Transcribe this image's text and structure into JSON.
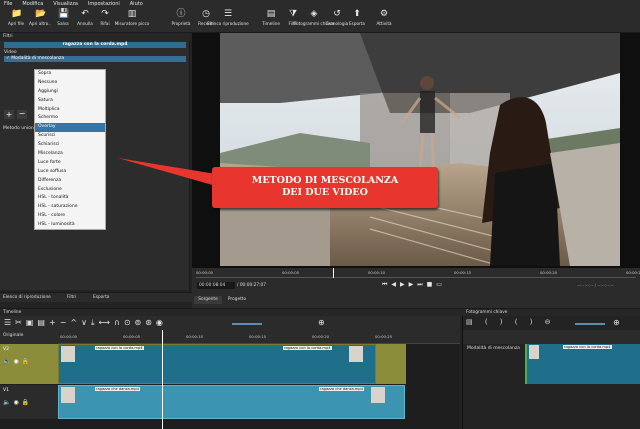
{
  "menu": [
    "File",
    "Modifica",
    "Visualizza",
    "Impostazioni",
    "Aiuto"
  ],
  "toolbar": [
    {
      "label": "Apri file",
      "icon": "folder-icon"
    },
    {
      "label": "Apri altro..",
      "icon": "folder-open-icon"
    },
    {
      "label": "Salva",
      "icon": "save-icon"
    },
    {
      "label": "Annulla",
      "icon": "undo-icon"
    },
    {
      "label": "Rifai",
      "icon": "redo-icon"
    },
    {
      "label": "Misuratore picco",
      "icon": "meter-icon"
    },
    {
      "label": "Proprietà",
      "icon": "info-icon"
    },
    {
      "label": "Recenti",
      "icon": "clock-icon"
    },
    {
      "label": "Elenco riproduzione",
      "icon": "list-icon"
    },
    {
      "label": "Timeline",
      "icon": "timeline-icon"
    },
    {
      "label": "Filtri",
      "icon": "filter-icon"
    },
    {
      "label": "Fotogrammi chiave",
      "icon": "keyframe-icon"
    },
    {
      "label": "Cronologia",
      "icon": "history-icon"
    },
    {
      "label": "Esporta",
      "icon": "export-icon"
    },
    {
      "label": "Attività",
      "icon": "jobs-icon"
    }
  ],
  "filters": {
    "panel_title": "Filtri",
    "clip_name": "ragazza con la corda.mp4",
    "section": "Video",
    "item": "✓ Modalità di mescolanza",
    "mode_label": "Metodo unione",
    "modes": [
      "Sopra",
      "Nessuno",
      "Aggiungi",
      "Satura",
      "Moltiplica",
      "Schermo",
      "Overlay",
      "Scurisci",
      "Schiarisci",
      "Miscelanza",
      "Luce forte",
      "Luce soffusa",
      "Differenza",
      "Esclusione",
      "HSL - tonalità",
      "HSL - saturazione",
      "HSL - colore",
      "HSL - luminosità"
    ],
    "selected": "Overlay"
  },
  "callout": [
    "METODO DI MESCOLANZA",
    "DEI DUE VIDEO"
  ],
  "player": {
    "ticks": [
      "00:00:00",
      "00:00:05",
      "00:00:10",
      "00:00:15",
      "00:00:20",
      "00:00:25"
    ],
    "position": "00:00:08:04",
    "duration": "/ 00:00:27:07",
    "tab_source": "Sorgente",
    "tab_project": "Progetto",
    "timecode_right": "--:--:--:-- / --:--:--:--"
  },
  "bottom_tabs": [
    "Elenco di riproduzione",
    "Filtri",
    "Esporta"
  ],
  "timeline": {
    "title": "Timeline",
    "kf_title": "Fotogrammi chiave",
    "master": "Originale",
    "tracks": [
      "V2",
      "V1"
    ],
    "ruler": [
      "00:00:00",
      "00:00:05",
      "00:00:10",
      "00:00:15",
      "00:00:20",
      "00:00:25"
    ],
    "clip_top": "ragazza con la corda.mp4",
    "clip_bottom": "ragazza che danza.mp4",
    "kf_filter": "Modalità di mescolanza",
    "kf_clip": "ragazza con la corda.mp4"
  }
}
